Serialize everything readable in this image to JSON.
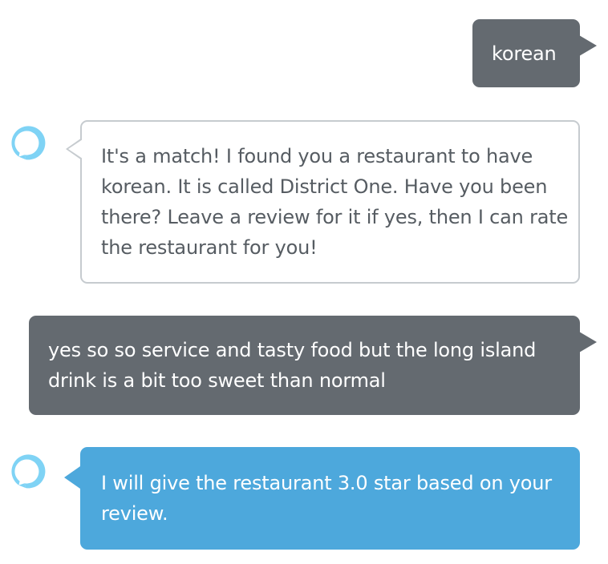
{
  "conversation": {
    "messages": [
      {
        "sender": "user",
        "text": "korean"
      },
      {
        "sender": "alexa",
        "text": "It's a match! I found you a restaurant to have korean. It is called District One. Have you been there? Leave a review for it if yes, then I can rate the restaurant for you!"
      },
      {
        "sender": "user",
        "text": "yes so so service and tasty food but the long island drink is a bit too sweet than normal"
      },
      {
        "sender": "alexa",
        "text": "I will give the restaurant 3.0 star based on your review."
      }
    ]
  },
  "icons": {
    "assistant_avatar": "alexa-ring-icon"
  },
  "colors": {
    "user_bubble": "#646a70",
    "alexa_bubble_border": "#c6cbcf",
    "alexa_bubble_text": "#565c62",
    "alexa_highlight_bubble": "#4da8dc",
    "alexa_ring": "#7fd3f5"
  }
}
